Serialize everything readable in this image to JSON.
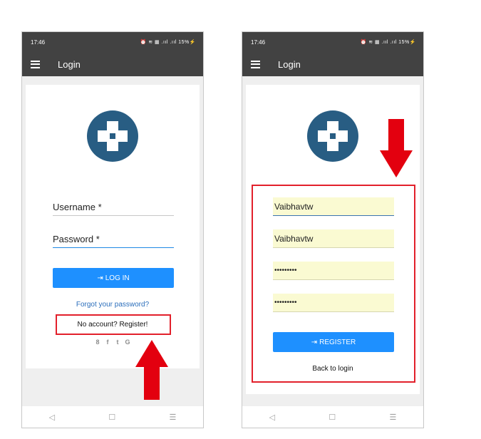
{
  "left_phone": {
    "status_time": "17:46",
    "status_icons": "⏰ ≋ ▦ .ııl .ııl 15%⚡",
    "appbar_title": "Login",
    "username_label": "Username *",
    "password_label": "Password *",
    "login_button": "LOG IN",
    "forgot_password": "Forgot your password?",
    "register_link": "No account? Register!",
    "social_icons": [
      "8",
      "f",
      "t",
      "G"
    ]
  },
  "right_phone": {
    "status_time": "17:46",
    "status_icons": "⏰ ≋ ▦ .ııl .ııl 15%⚡",
    "appbar_title": "Login",
    "field1_value": "Vaibhavtw",
    "field2_value": "Vaibhavtw",
    "password_value": "•••••••••",
    "confirm_password_value": "•••••••••",
    "register_button": "REGISTER",
    "back_to_login": "Back to login"
  },
  "nav_icons": [
    "◁",
    "☐",
    "☰"
  ],
  "colors": {
    "appbar": "#424242",
    "primary": "#1e90ff",
    "link": "#2a6ebb",
    "highlight": "#e2202b",
    "logo": "#285d83",
    "autofill": "#fafad2"
  }
}
